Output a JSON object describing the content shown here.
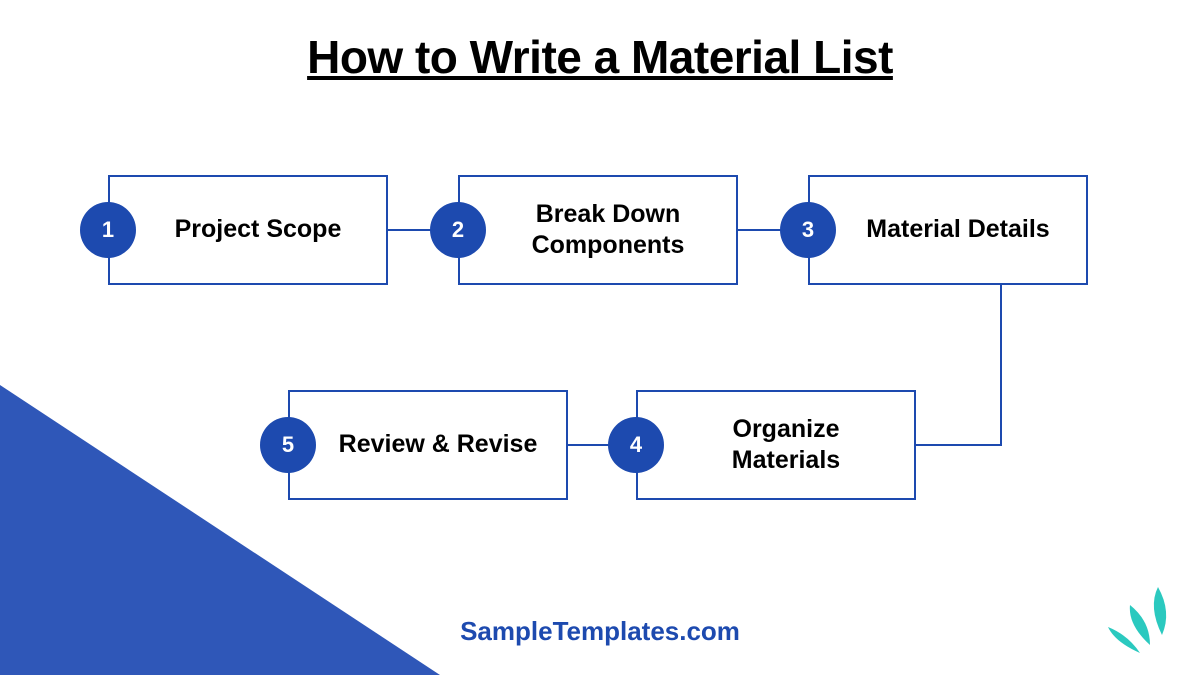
{
  "title": "How to Write a Material List",
  "steps": [
    {
      "num": "1",
      "label": "Project Scope"
    },
    {
      "num": "2",
      "label": "Break Down Components"
    },
    {
      "num": "3",
      "label": "Material Details"
    },
    {
      "num": "4",
      "label": "Organize Materials"
    },
    {
      "num": "5",
      "label": "Review & Revise"
    }
  ],
  "footer": "SampleTemplates.com",
  "colors": {
    "primary": "#1d4aaf",
    "triangle": "#2f57b8",
    "accent": "#2bc9bf"
  }
}
